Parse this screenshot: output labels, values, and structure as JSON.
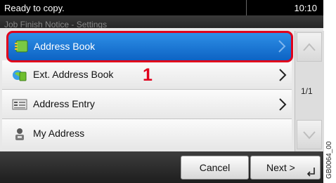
{
  "status": {
    "message": "Ready to copy.",
    "time": "10:10"
  },
  "screen": {
    "title": "Job Finish Notice - Settings"
  },
  "list": {
    "items": [
      {
        "label": "Address Book",
        "icon": "address-book-icon",
        "selected": true
      },
      {
        "label": "Ext. Address Book",
        "icon": "ext-address-book-icon"
      },
      {
        "label": "Address Entry",
        "icon": "address-entry-icon"
      },
      {
        "label": "My Address",
        "icon": "my-address-icon"
      }
    ]
  },
  "pager": {
    "indicator": "1/1"
  },
  "callout": {
    "number": "1"
  },
  "footer": {
    "cancel_label": "Cancel",
    "next_label": "Next >"
  },
  "side_label": "GB0064_00",
  "colors": {
    "highlight": "#e0001b",
    "selected_row": "#1f78d6"
  }
}
